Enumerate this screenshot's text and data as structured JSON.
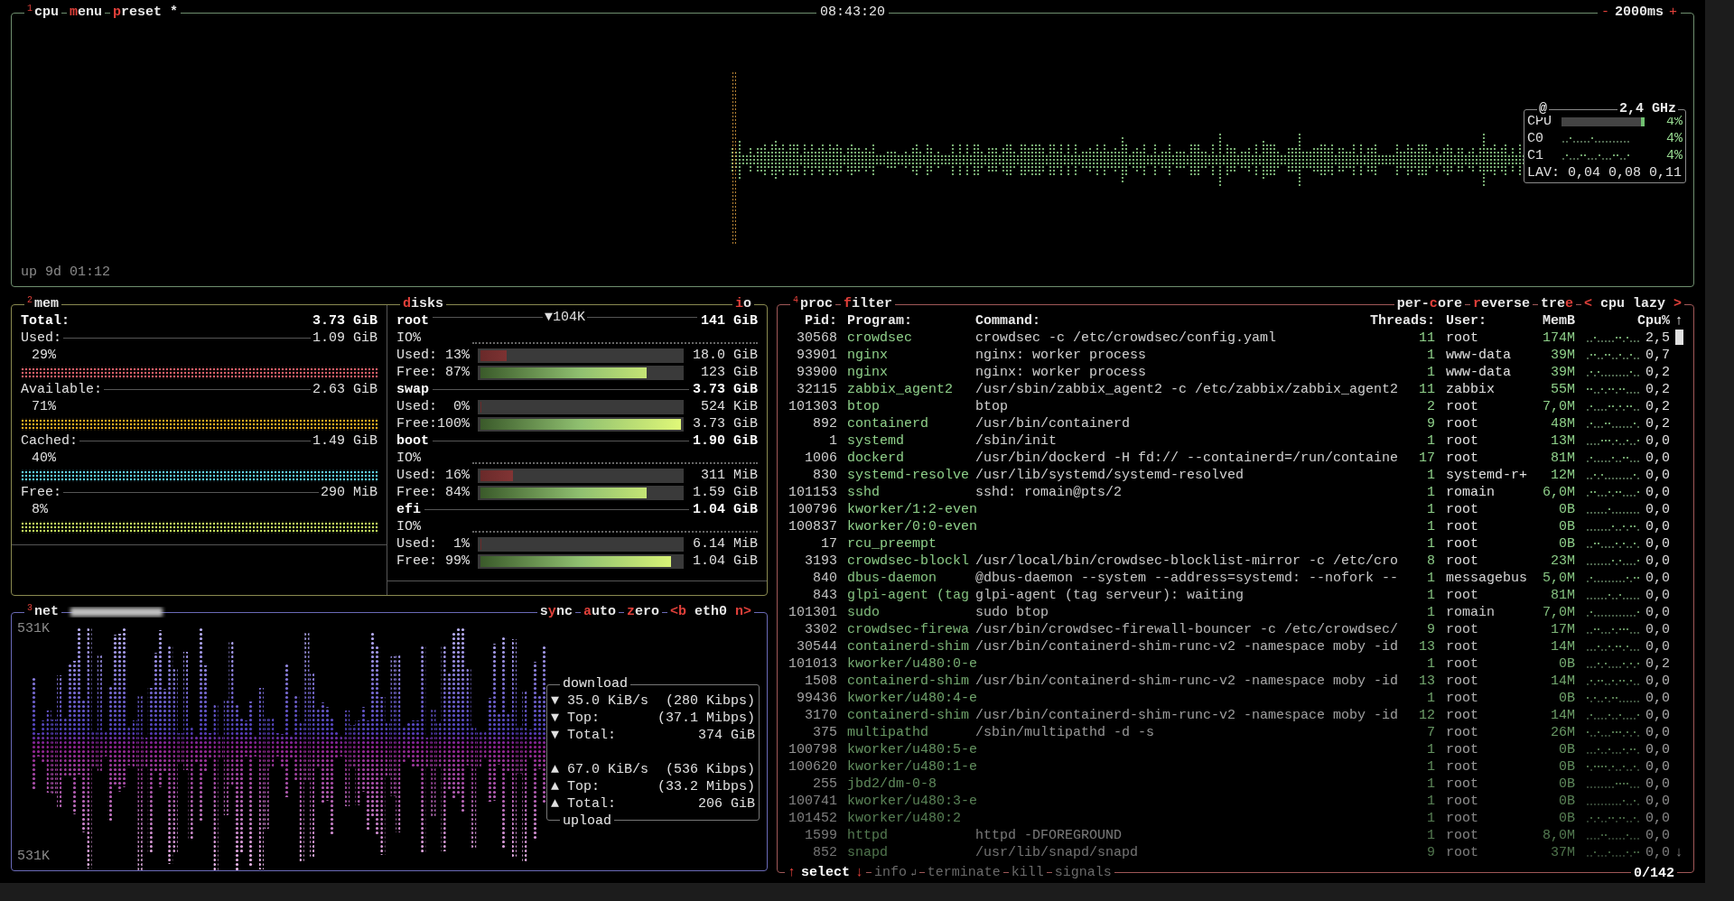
{
  "cpu_box": {
    "number": "1",
    "title": "cpu",
    "menu": [
      {
        "key": "m",
        "after": "enu"
      },
      {
        "key": "p",
        "after": "reset *"
      }
    ],
    "clock": "08:43:20",
    "interval": {
      "minus": "-",
      "value": "2000ms",
      "plus": "+"
    },
    "uptime": "up 9d 01:12",
    "meter": {
      "at": "@",
      "freq": "2,4 GHz",
      "rows": [
        {
          "kind": "bar",
          "label": "CPU",
          "level": 0.04,
          "reading": "4%"
        },
        {
          "kind": "sparkline",
          "label": "C0",
          "reading": "4%"
        },
        {
          "kind": "sparkline",
          "label": "C1",
          "reading": "4%"
        }
      ],
      "load": "LAV: 0,04 0,08 0,11"
    }
  },
  "mem_box": {
    "number": "2",
    "title": "mem",
    "items": [
      {
        "label": "Total:",
        "value": "3.73 GiB"
      },
      {
        "label": "Used:",
        "value": "1.09 GiB",
        "percent": "29%",
        "color": "#e0606a"
      },
      {
        "label": "Available:",
        "value": "2.63 GiB",
        "percent": "71%",
        "color": "#f0b020"
      },
      {
        "label": "Cached:",
        "value": "1.49 GiB",
        "percent": "40%",
        "color": "#60d8f0"
      },
      {
        "label": "Free:",
        "value": "290 MiB",
        "percent": "8%",
        "color": "#c8e860"
      }
    ]
  },
  "disks_box": {
    "title": {
      "key": "d",
      "after": "isks"
    },
    "io": {
      "key": "i",
      "after": "o"
    },
    "disks": [
      {
        "name": "root",
        "total": "141 GiB",
        "io_rate": "▼104K",
        "io_label": "IO%",
        "used": {
          "label": "Used: 13%",
          "level": 0.13,
          "value": "18.0 GiB"
        },
        "free": {
          "label": "Free: 87%",
          "level": 0.83,
          "value": "123 GiB"
        }
      },
      {
        "name": "swap",
        "total": "3.73 GiB",
        "used": {
          "label": "Used:  0%",
          "level": 0,
          "value": "524 KiB"
        },
        "free": {
          "label": "Free:100%",
          "level": 1,
          "value": "3.73 GiB"
        }
      },
      {
        "name": "boot",
        "total": "1.90 GiB",
        "io_label": "IO%",
        "used": {
          "label": "Used: 16%",
          "level": 0.16,
          "value": "311 MiB"
        },
        "free": {
          "label": "Free: 84%",
          "level": 0.83,
          "value": "1.59 GiB"
        }
      },
      {
        "name": "efi",
        "total": "1.04 GiB",
        "io_label": "IO%",
        "used": {
          "label": "Used:  1%",
          "level": 0.0,
          "value": "6.14 MiB"
        },
        "free": {
          "label": "Free: 99%",
          "level": 0.95,
          "value": "1.04 GiB"
        }
      }
    ]
  },
  "net_box": {
    "number": "3",
    "title": "net",
    "controls": [
      {
        "before": "s",
        "key": "y",
        "after": "nc"
      },
      {
        "key": "a",
        "after": "uto"
      },
      {
        "key": "z",
        "after": "ero"
      }
    ],
    "interface": {
      "prev": "<b",
      "name": "eth0",
      "next": "n>"
    },
    "scale_top": "531K",
    "scale_bottom": "531K",
    "download": {
      "title": "download",
      "rows": [
        {
          "arrow": "▼",
          "label": "35.0 KiB/s",
          "value": "(280 Kibps)"
        },
        {
          "arrow": "▼",
          "label": "Top:",
          "value": "(37.1 Mibps)"
        },
        {
          "arrow": "▼",
          "label": "Total:",
          "value": "374 GiB"
        }
      ]
    },
    "upload": {
      "title": "upload",
      "rows": [
        {
          "arrow": "▲",
          "label": "67.0 KiB/s",
          "value": "(536 Kibps)"
        },
        {
          "arrow": "▲",
          "label": "Top:",
          "value": "(33.2 Mibps)"
        },
        {
          "arrow": "▲",
          "label": "Total:",
          "value": "206 GiB"
        }
      ]
    }
  },
  "proc_box": {
    "number": "4",
    "title": "proc",
    "filter": {
      "key": "f",
      "after": "ilter"
    },
    "options": [
      {
        "before": "per-",
        "key": "c",
        "after": "ore"
      },
      {
        "key": "r",
        "after": "everse"
      },
      {
        "before": "tre",
        "key": "e"
      }
    ],
    "sort": {
      "prev": "<",
      "label": "cpu lazy",
      "next": ">"
    },
    "columns": [
      "Pid:",
      "Program:",
      "Command:",
      "Threads:",
      "User:",
      "MemB",
      "Cpu%"
    ],
    "scroll_up": "↑",
    "scroll_down": "↓",
    "rows": [
      {
        "pid": "30568",
        "program": "crowdsec",
        "command": "crowdsec -c /etc/crowdsec/config.yaml",
        "threads": "11",
        "user": "root",
        "mem": "174M",
        "cpu": "2,5"
      },
      {
        "pid": "93901",
        "program": "nginx",
        "command": "nginx: worker process",
        "threads": "1",
        "user": "www-data",
        "mem": "39M",
        "cpu": "0,7"
      },
      {
        "pid": "93900",
        "program": "nginx",
        "command": "nginx: worker process",
        "threads": "1",
        "user": "www-data",
        "mem": "39M",
        "cpu": "0,2"
      },
      {
        "pid": "32115",
        "program": "zabbix_agent2",
        "command": "/usr/sbin/zabbix_agent2 -c /etc/zabbix/zabbix_agent2",
        "threads": "11",
        "user": "zabbix",
        "mem": "55M",
        "cpu": "0,2"
      },
      {
        "pid": "101303",
        "program": "btop",
        "command": "btop",
        "threads": "2",
        "user": "root",
        "mem": "7,0M",
        "cpu": "0,2"
      },
      {
        "pid": "892",
        "program": "containerd",
        "command": "/usr/bin/containerd",
        "threads": "9",
        "user": "root",
        "mem": "48M",
        "cpu": "0,2"
      },
      {
        "pid": "1",
        "program": "systemd",
        "command": "/sbin/init",
        "threads": "1",
        "user": "root",
        "mem": "13M",
        "cpu": "0,0"
      },
      {
        "pid": "1006",
        "program": "dockerd",
        "command": "/usr/bin/dockerd -H fd:// --containerd=/run/containe",
        "threads": "17",
        "user": "root",
        "mem": "81M",
        "cpu": "0,0"
      },
      {
        "pid": "830",
        "program": "systemd-resolve",
        "command": "/usr/lib/systemd/systemd-resolved",
        "threads": "1",
        "user": "systemd-r+",
        "mem": "12M",
        "cpu": "0,0"
      },
      {
        "pid": "101153",
        "program": "sshd",
        "command": "sshd: romain@pts/2",
        "threads": "1",
        "user": "romain",
        "mem": "6,0M",
        "cpu": "0,0"
      },
      {
        "pid": "100796",
        "program": "kworker/1:2-even",
        "threads": "1",
        "user": "root",
        "mem": "0B",
        "cpu": "0,0"
      },
      {
        "pid": "100837",
        "program": "kworker/0:0-even",
        "threads": "1",
        "user": "root",
        "mem": "0B",
        "cpu": "0,0"
      },
      {
        "pid": "17",
        "program": "rcu_preempt",
        "threads": "1",
        "user": "root",
        "mem": "0B",
        "cpu": "0,0"
      },
      {
        "pid": "3193",
        "program": "crowdsec-blockl",
        "command": "/usr/local/bin/crowdsec-blocklist-mirror -c /etc/cro",
        "threads": "8",
        "user": "root",
        "mem": "23M",
        "cpu": "0,0"
      },
      {
        "pid": "840",
        "program": "dbus-daemon",
        "command": "@dbus-daemon --system --address=systemd: --nofork --",
        "threads": "1",
        "user": "messagebus",
        "mem": "5,0M",
        "cpu": "0,0"
      },
      {
        "pid": "843",
        "program": "glpi-agent (tag",
        "command": "glpi-agent (tag serveur): waiting",
        "threads": "1",
        "user": "root",
        "mem": "81M",
        "cpu": "0,0"
      },
      {
        "pid": "101301",
        "program": "sudo",
        "command": "sudo btop",
        "threads": "1",
        "user": "romain",
        "mem": "7,0M",
        "cpu": "0,0"
      },
      {
        "pid": "3302",
        "program": "crowdsec-firewa",
        "command": "/usr/bin/crowdsec-firewall-bouncer -c /etc/crowdsec/",
        "threads": "9",
        "user": "root",
        "mem": "17M",
        "cpu": "0,0"
      },
      {
        "pid": "30544",
        "program": "containerd-shim",
        "command": "/usr/bin/containerd-shim-runc-v2 -namespace moby -id",
        "threads": "13",
        "user": "root",
        "mem": "14M",
        "cpu": "0,0"
      },
      {
        "pid": "101013",
        "program": "kworker/u480:0-e",
        "threads": "1",
        "user": "root",
        "mem": "0B",
        "cpu": "0,2"
      },
      {
        "pid": "1508",
        "program": "containerd-shim",
        "command": "/usr/bin/containerd-shim-runc-v2 -namespace moby -id",
        "threads": "13",
        "user": "root",
        "mem": "14M",
        "cpu": "0,0"
      },
      {
        "pid": "99436",
        "program": "kworker/u480:4-e",
        "threads": "1",
        "user": "root",
        "mem": "0B",
        "cpu": "0,0"
      },
      {
        "pid": "3170",
        "program": "containerd-shim",
        "command": "/usr/bin/containerd-shim-runc-v2 -namespace moby -id",
        "threads": "12",
        "user": "root",
        "mem": "14M",
        "cpu": "0,0"
      },
      {
        "pid": "375",
        "program": "multipathd",
        "command": "/sbin/multipathd -d -s",
        "threads": "7",
        "user": "root",
        "mem": "26M",
        "cpu": "0,0"
      },
      {
        "pid": "100798",
        "program": "kworker/u480:5-e",
        "threads": "1",
        "user": "root",
        "mem": "0B",
        "cpu": "0,0"
      },
      {
        "pid": "100620",
        "program": "kworker/u480:1-e",
        "threads": "1",
        "user": "root",
        "mem": "0B",
        "cpu": "0,0"
      },
      {
        "pid": "255",
        "program": "jbd2/dm-0-8",
        "threads": "1",
        "user": "root",
        "mem": "0B",
        "cpu": "0,0"
      },
      {
        "pid": "100741",
        "program": "kworker/u480:3-e",
        "threads": "1",
        "user": "root",
        "mem": "0B",
        "cpu": "0,0"
      },
      {
        "pid": "101452",
        "program": "kworker/u480:2",
        "threads": "1",
        "user": "root",
        "mem": "0B",
        "cpu": "0,0"
      },
      {
        "pid": "1599",
        "program": "httpd",
        "command": "httpd -DFOREGROUND",
        "threads": "1",
        "user": "root",
        "mem": "8,0M",
        "cpu": "0,0"
      },
      {
        "pid": "852",
        "program": "snapd",
        "command": "/usr/lib/snapd/snapd",
        "threads": "9",
        "user": "root",
        "mem": "37M",
        "cpu": "0,0"
      }
    ],
    "footer": {
      "select": {
        "up": "↑",
        "label": "select",
        "down": "↓"
      },
      "actions": [
        {
          "label": "info",
          "suffix": "↲",
          "disabled": true
        },
        {
          "label": "terminate",
          "disabled": true
        },
        {
          "label": "kill",
          "disabled": true
        },
        {
          "label": "signals",
          "disabled": true
        }
      ],
      "count": "0/142"
    }
  }
}
